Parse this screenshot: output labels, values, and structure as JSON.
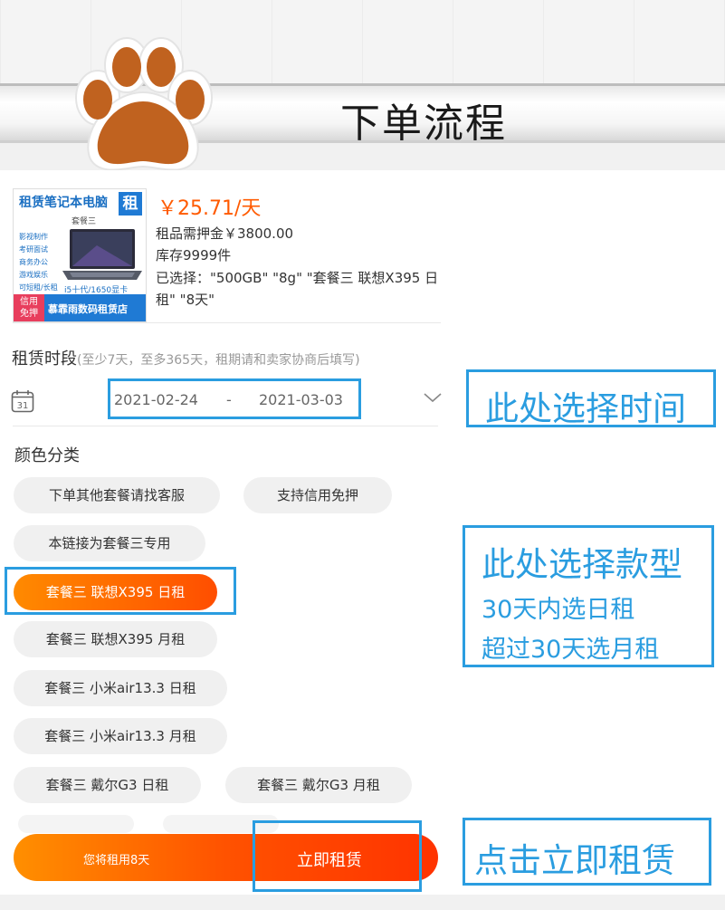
{
  "banner": {
    "title": "下单流程"
  },
  "product": {
    "thumbnail": {
      "heading": "租赁笔记本电脑",
      "badge": "租",
      "subtitle": "套餐三",
      "features": [
        "影视制作",
        "考研面试",
        "商务办公",
        "游戏娱乐",
        "可短租/长租"
      ],
      "spec": "i5十代/1650显卡",
      "footer_left": [
        "信用",
        "免押"
      ],
      "footer_right": "慕霏雨数码租赁店"
    },
    "price": "￥25.71/天",
    "deposit": "租品需押金￥3800.00",
    "stock": "库存9999件",
    "selected_line1": "已选择：\"500GB\" \"8g\" \"套餐三 联想X395 日",
    "selected_line2": "租\" \"8天\""
  },
  "period": {
    "label": "租赁时段",
    "hint": "(至少7天，至多365天，租期请和卖家协商后填写)",
    "calendar_day": "31",
    "start_date": "2021-02-24",
    "separator": "-",
    "end_date": "2021-03-03"
  },
  "color_category": {
    "label": "颜色分类",
    "options": [
      {
        "label": "下单其他套餐请找客服",
        "selected": false
      },
      {
        "label": "支持信用免押",
        "selected": false
      },
      {
        "label": "本链接为套餐三专用",
        "selected": false
      },
      {
        "label": "套餐三 联想X395 日租",
        "selected": true
      },
      {
        "label": "套餐三 联想X395 月租",
        "selected": false
      },
      {
        "label": "套餐三 小米air13.3 日租",
        "selected": false
      },
      {
        "label": "套餐三 小米air13.3 月租",
        "selected": false
      },
      {
        "label": "套餐三 戴尔G3 日租",
        "selected": false
      },
      {
        "label": "套餐三 戴尔G3 月租",
        "selected": false
      }
    ]
  },
  "cta": {
    "rent_days": "您将租用8天",
    "button": "立即租赁"
  },
  "annotations": {
    "time": "此处选择时间",
    "model_title": "此处选择款型",
    "model_line1": "30天内选日租",
    "model_line2": "超过30天选月租",
    "click": "点击立即租赁"
  },
  "colors": {
    "accent": "#ff5a00",
    "annotation": "#2a9de0",
    "paw": "#c0621f"
  }
}
